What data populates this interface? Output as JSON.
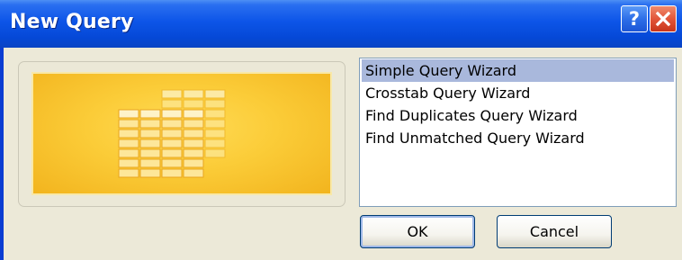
{
  "window": {
    "title": "New Query"
  },
  "titlebar": {
    "help_icon": "help-icon",
    "close_icon": "close-icon"
  },
  "preview": {
    "icon": "table-grid-icon"
  },
  "list": {
    "items": [
      {
        "label": "Simple Query Wizard",
        "selected": true
      },
      {
        "label": "Crosstab Query Wizard",
        "selected": false
      },
      {
        "label": "Find Duplicates Query Wizard",
        "selected": false
      },
      {
        "label": "Find Unmatched Query Wizard",
        "selected": false
      }
    ]
  },
  "buttons": {
    "ok_label": "OK",
    "cancel_label": "Cancel"
  },
  "colors": {
    "titlebar": "#0548d6",
    "dialog_background": "#ece9d8",
    "selection": "#a9b8dc",
    "close_button": "#e2563a",
    "preview_background": "#fbcc38"
  }
}
